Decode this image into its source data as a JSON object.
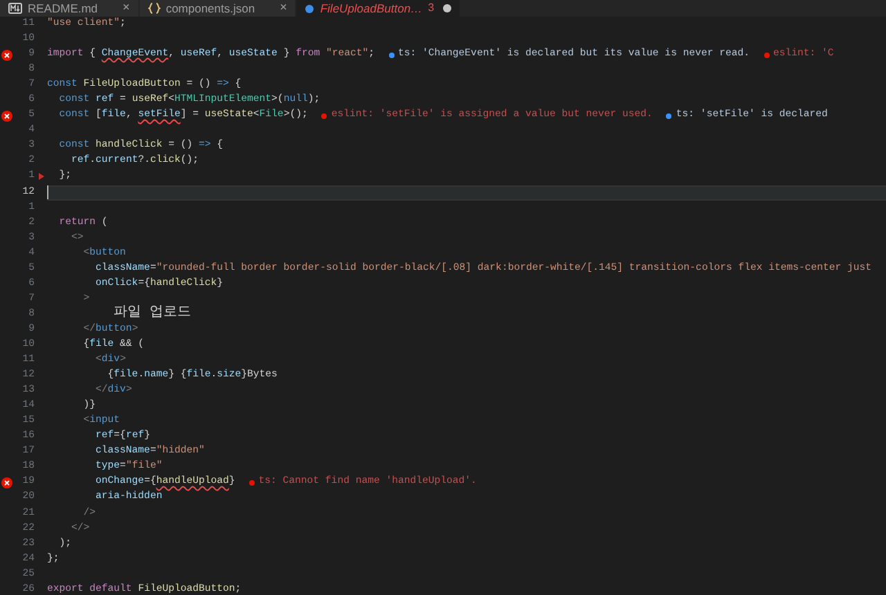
{
  "tabs": [
    {
      "label": "README.md",
      "kind": "markdown",
      "selected": false,
      "error": false,
      "close": "×",
      "modified": false
    },
    {
      "label": "components.json",
      "kind": "json",
      "selected": false,
      "error": false,
      "close": "×",
      "modified": false
    },
    {
      "label": "FileUploadButton…",
      "kind": "react",
      "selected": true,
      "error": true,
      "badge": "3",
      "modified": true
    }
  ],
  "lines": [
    {
      "number": "11",
      "error": false,
      "pointer": false,
      "current": false,
      "tokens": [
        {
          "text": "\"use client\"",
          "kind": "str"
        },
        {
          "text": ";",
          "kind": "p"
        }
      ]
    },
    {
      "number": "10",
      "error": false,
      "pointer": false,
      "current": false
    },
    {
      "number": "9",
      "error": true,
      "pointer": false,
      "current": false,
      "tokens": [
        {
          "text": "import",
          "kind": "ctrl"
        },
        {
          "text": " { ",
          "kind": "p"
        },
        {
          "text": "ChangeEvent",
          "kind": "var",
          "squiggle": true
        },
        {
          "text": ", ",
          "kind": "p"
        },
        {
          "text": "useRef",
          "kind": "var"
        },
        {
          "text": ", ",
          "kind": "p"
        },
        {
          "text": "useState",
          "kind": "var"
        },
        {
          "text": " } ",
          "kind": "p"
        },
        {
          "text": "from",
          "kind": "ctrl"
        },
        {
          "text": " \"react\"",
          "kind": "str"
        },
        {
          "text": ";",
          "kind": "p"
        }
      ],
      "diagnostics": [
        {
          "kind": "info",
          "text": "ts: 'ChangeEvent' is declared but its value is never read."
        },
        {
          "kind": "error",
          "text": "eslint: 'C"
        }
      ]
    },
    {
      "number": "8",
      "error": false,
      "pointer": false,
      "current": false
    },
    {
      "number": "7",
      "error": false,
      "pointer": false,
      "current": false,
      "tokens": [
        {
          "text": "const",
          "kind": "kw"
        },
        {
          "text": " FileUploadButton",
          "kind": "fn"
        },
        {
          "text": " = () ",
          "kind": "p"
        },
        {
          "text": "=>",
          "kind": "kw"
        },
        {
          "text": " {",
          "kind": "p"
        }
      ]
    },
    {
      "number": "6",
      "error": false,
      "pointer": false,
      "current": false,
      "tokens": [
        {
          "text": "  const",
          "kind": "kw"
        },
        {
          "text": " ref",
          "kind": "var"
        },
        {
          "text": " = ",
          "kind": "p"
        },
        {
          "text": "useRef",
          "kind": "fn"
        },
        {
          "text": "<",
          "kind": "p"
        },
        {
          "text": "HTMLInputElement",
          "kind": "type"
        },
        {
          "text": ">(",
          "kind": "p"
        },
        {
          "text": "null",
          "kind": "kw"
        },
        {
          "text": ");",
          "kind": "p"
        }
      ]
    },
    {
      "number": "5",
      "error": true,
      "pointer": false,
      "current": false,
      "tokens": [
        {
          "text": "  const",
          "kind": "kw"
        },
        {
          "text": " [",
          "kind": "p"
        },
        {
          "text": "file",
          "kind": "var"
        },
        {
          "text": ", ",
          "kind": "p"
        },
        {
          "text": "setFile",
          "kind": "var",
          "squiggle": true
        },
        {
          "text": "] = ",
          "kind": "p"
        },
        {
          "text": "useState",
          "kind": "fn"
        },
        {
          "text": "<",
          "kind": "p"
        },
        {
          "text": "File",
          "kind": "type"
        },
        {
          "text": ">();",
          "kind": "p"
        }
      ],
      "diagnostics": [
        {
          "kind": "error",
          "text": "eslint: 'setFile' is assigned a value but never used."
        },
        {
          "kind": "info",
          "text": "ts: 'setFile' is declared"
        }
      ]
    },
    {
      "number": "4",
      "error": false,
      "pointer": false,
      "current": false
    },
    {
      "number": "3",
      "error": false,
      "pointer": false,
      "current": false,
      "tokens": [
        {
          "text": "  const",
          "kind": "kw"
        },
        {
          "text": " handleClick",
          "kind": "fn"
        },
        {
          "text": " = () ",
          "kind": "p"
        },
        {
          "text": "=>",
          "kind": "kw"
        },
        {
          "text": " {",
          "kind": "p"
        }
      ]
    },
    {
      "number": "2",
      "error": false,
      "pointer": false,
      "current": false,
      "tokens": [
        {
          "text": "    ref",
          "kind": "var"
        },
        {
          "text": ".",
          "kind": "p"
        },
        {
          "text": "current",
          "kind": "var"
        },
        {
          "text": "?.",
          "kind": "p"
        },
        {
          "text": "click",
          "kind": "fn"
        },
        {
          "text": "();",
          "kind": "p"
        }
      ]
    },
    {
      "number": "1",
      "error": false,
      "pointer": true,
      "current": false,
      "tokens": [
        {
          "text": "  };",
          "kind": "p"
        }
      ]
    },
    {
      "number": "12",
      "error": false,
      "pointer": false,
      "current": true
    },
    {
      "number": "1",
      "error": false,
      "pointer": false,
      "current": false
    },
    {
      "number": "2",
      "error": false,
      "pointer": false,
      "current": false,
      "tokens": [
        {
          "text": "  return",
          "kind": "ctrl"
        },
        {
          "text": " (",
          "kind": "p"
        }
      ]
    },
    {
      "number": "3",
      "error": false,
      "pointer": false,
      "current": false,
      "tokens": [
        {
          "text": "    <>",
          "kind": "tag"
        }
      ]
    },
    {
      "number": "4",
      "error": false,
      "pointer": false,
      "current": false,
      "tokens": [
        {
          "text": "      <",
          "kind": "tag"
        },
        {
          "text": "button",
          "kind": "tagname"
        }
      ]
    },
    {
      "number": "5",
      "error": false,
      "pointer": false,
      "current": false,
      "tokens": [
        {
          "text": "        className",
          "kind": "attr"
        },
        {
          "text": "=",
          "kind": "p"
        },
        {
          "text": "\"rounded-full border border-solid border-black/[.08] dark:border-white/[.145] transition-colors flex items-center just",
          "kind": "str"
        }
      ]
    },
    {
      "number": "6",
      "error": false,
      "pointer": false,
      "current": false,
      "tokens": [
        {
          "text": "        onClick",
          "kind": "attr"
        },
        {
          "text": "={",
          "kind": "p"
        },
        {
          "text": "handleClick",
          "kind": "fn"
        },
        {
          "text": "}",
          "kind": "p"
        }
      ]
    },
    {
      "number": "7",
      "error": false,
      "pointer": false,
      "current": false,
      "tokens": [
        {
          "text": "      >",
          "kind": "tag"
        }
      ]
    },
    {
      "number": "8",
      "error": false,
      "pointer": false,
      "current": false,
      "tokens": [
        {
          "text": "        파일 업로드",
          "kind": "cjk"
        }
      ]
    },
    {
      "number": "9",
      "error": false,
      "pointer": false,
      "current": false,
      "tokens": [
        {
          "text": "      </",
          "kind": "tag"
        },
        {
          "text": "button",
          "kind": "tagname"
        },
        {
          "text": ">",
          "kind": "tag"
        }
      ]
    },
    {
      "number": "10",
      "error": false,
      "pointer": false,
      "current": false,
      "tokens": [
        {
          "text": "      {",
          "kind": "p"
        },
        {
          "text": "file",
          "kind": "var"
        },
        {
          "text": " && (",
          "kind": "p"
        }
      ]
    },
    {
      "number": "11",
      "error": false,
      "pointer": false,
      "current": false,
      "tokens": [
        {
          "text": "        <",
          "kind": "tag"
        },
        {
          "text": "div",
          "kind": "tagname"
        },
        {
          "text": ">",
          "kind": "tag"
        }
      ]
    },
    {
      "number": "12",
      "error": false,
      "pointer": false,
      "current": false,
      "tokens": [
        {
          "text": "          {",
          "kind": "p"
        },
        {
          "text": "file",
          "kind": "var"
        },
        {
          "text": ".",
          "kind": "p"
        },
        {
          "text": "name",
          "kind": "var"
        },
        {
          "text": "} {",
          "kind": "p"
        },
        {
          "text": "file",
          "kind": "var"
        },
        {
          "text": ".",
          "kind": "p"
        },
        {
          "text": "size",
          "kind": "var"
        },
        {
          "text": "}Bytes",
          "kind": "p"
        }
      ]
    },
    {
      "number": "13",
      "error": false,
      "pointer": false,
      "current": false,
      "tokens": [
        {
          "text": "        </",
          "kind": "tag"
        },
        {
          "text": "div",
          "kind": "tagname"
        },
        {
          "text": ">",
          "kind": "tag"
        }
      ]
    },
    {
      "number": "14",
      "error": false,
      "pointer": false,
      "current": false,
      "tokens": [
        {
          "text": "      )}",
          "kind": "p"
        }
      ]
    },
    {
      "number": "15",
      "error": false,
      "pointer": false,
      "current": false,
      "tokens": [
        {
          "text": "      <",
          "kind": "tag"
        },
        {
          "text": "input",
          "kind": "tagname"
        }
      ]
    },
    {
      "number": "16",
      "error": false,
      "pointer": false,
      "current": false,
      "tokens": [
        {
          "text": "        ref",
          "kind": "attr"
        },
        {
          "text": "={",
          "kind": "p"
        },
        {
          "text": "ref",
          "kind": "var"
        },
        {
          "text": "}",
          "kind": "p"
        }
      ]
    },
    {
      "number": "17",
      "error": false,
      "pointer": false,
      "current": false,
      "tokens": [
        {
          "text": "        className",
          "kind": "attr"
        },
        {
          "text": "=",
          "kind": "p"
        },
        {
          "text": "\"hidden\"",
          "kind": "str"
        }
      ]
    },
    {
      "number": "18",
      "error": false,
      "pointer": false,
      "current": false,
      "tokens": [
        {
          "text": "        type",
          "kind": "attr"
        },
        {
          "text": "=",
          "kind": "p"
        },
        {
          "text": "\"file\"",
          "kind": "str"
        }
      ]
    },
    {
      "number": "19",
      "error": true,
      "pointer": false,
      "current": false,
      "tokens": [
        {
          "text": "        onChange",
          "kind": "attr"
        },
        {
          "text": "={",
          "kind": "p"
        },
        {
          "text": "handleUpload",
          "kind": "fn",
          "squiggle": true
        },
        {
          "text": "}",
          "kind": "p"
        }
      ],
      "diagnostics": [
        {
          "kind": "error",
          "text": "ts: Cannot find name 'handleUpload'."
        }
      ]
    },
    {
      "number": "20",
      "error": false,
      "pointer": false,
      "current": false,
      "tokens": [
        {
          "text": "        aria-hidden",
          "kind": "attr"
        }
      ]
    },
    {
      "number": "21",
      "error": false,
      "pointer": false,
      "current": false,
      "tokens": [
        {
          "text": "      />",
          "kind": "tag"
        }
      ]
    },
    {
      "number": "22",
      "error": false,
      "pointer": false,
      "current": false,
      "tokens": [
        {
          "text": "    </>",
          "kind": "tag"
        }
      ]
    },
    {
      "number": "23",
      "error": false,
      "pointer": false,
      "current": false,
      "tokens": [
        {
          "text": "  );",
          "kind": "p"
        }
      ]
    },
    {
      "number": "24",
      "error": false,
      "pointer": false,
      "current": false,
      "tokens": [
        {
          "text": "};",
          "kind": "p"
        }
      ]
    },
    {
      "number": "25",
      "error": false,
      "pointer": false,
      "current": false
    },
    {
      "number": "26",
      "error": false,
      "pointer": false,
      "current": false,
      "tokens": [
        {
          "text": "export",
          "kind": "ctrl"
        },
        {
          "text": " default",
          "kind": "ctrl"
        },
        {
          "text": " FileUploadButton",
          "kind": "fn"
        },
        {
          "text": ";",
          "kind": "p"
        }
      ]
    }
  ]
}
